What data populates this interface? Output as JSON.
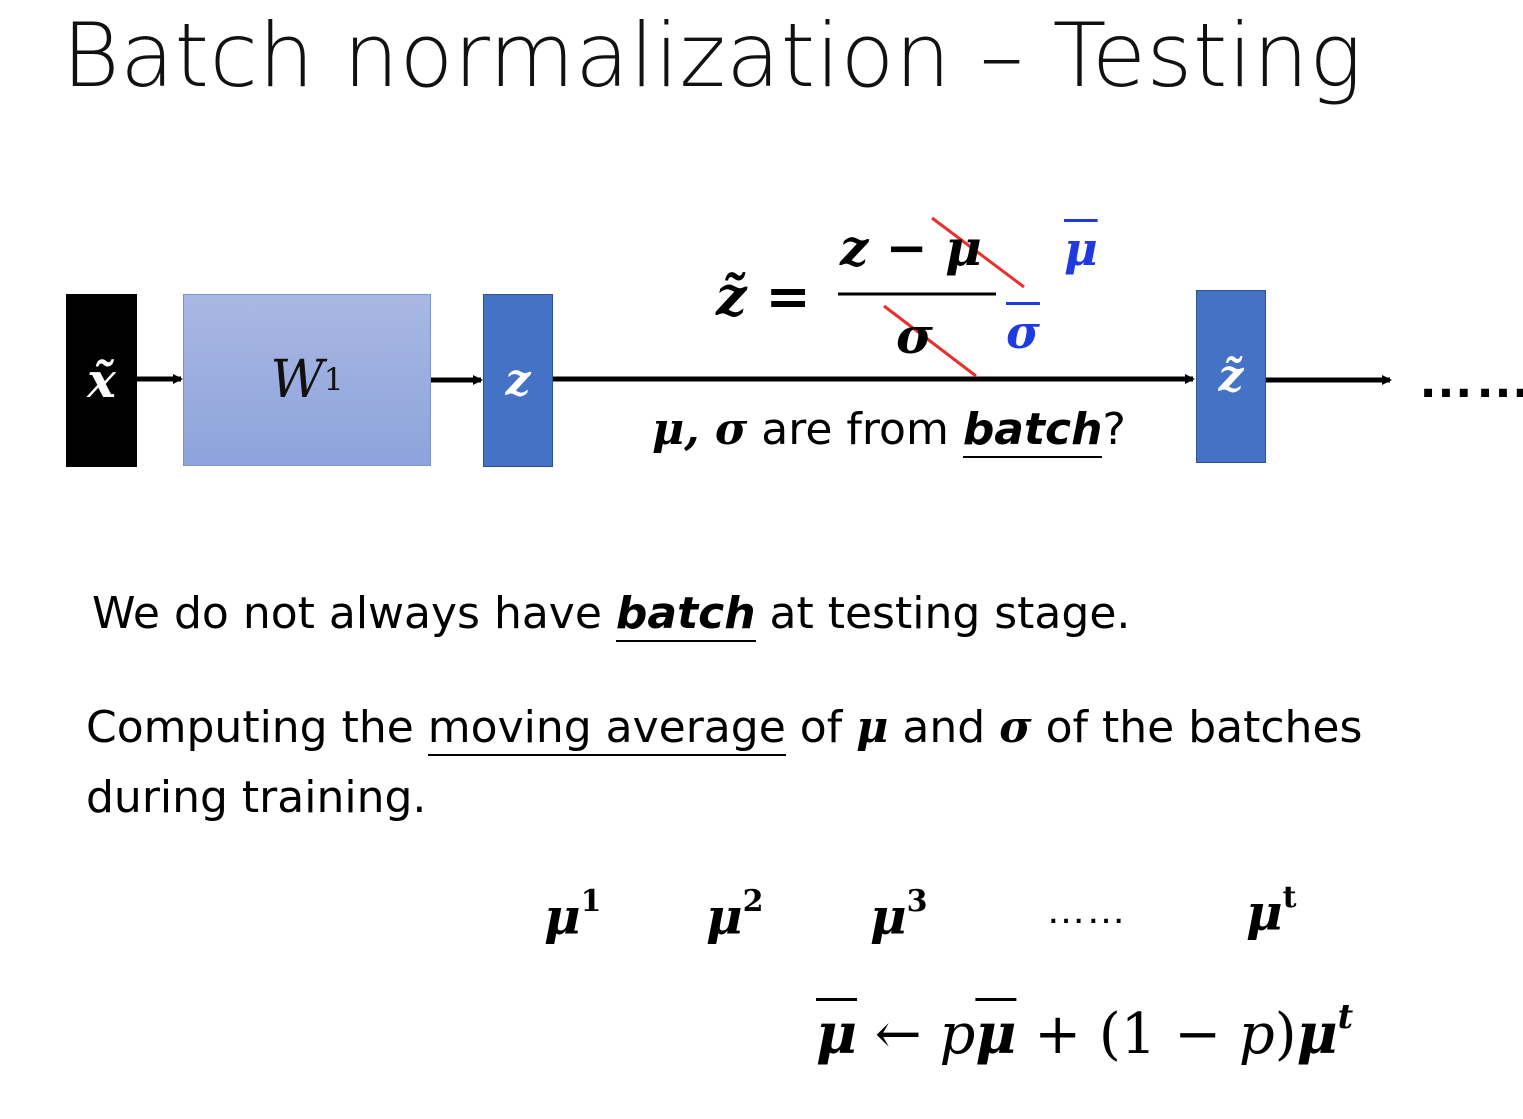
{
  "title": "Batch normalization – Testing",
  "diagram": {
    "input_label": "x̃",
    "weight_label": "W",
    "weight_superscript": "1",
    "z_label": "z",
    "z_tilde_label": "z̃",
    "trailing_dots": "……",
    "formula": {
      "lhs": "z̃ =",
      "numerator": "z − μ",
      "denominator": "σ",
      "replacement_mu": "μ",
      "replacement_sigma": "σ"
    },
    "caption": {
      "prefix": "μ, σ",
      "middle": " are from ",
      "emphasis": "batch",
      "suffix": "?"
    },
    "colors": {
      "black_box": "#000000",
      "weight_box": "#a9b8e3",
      "z_box": "#4472c4",
      "strike": "#e8302f",
      "replacement": "#1f3be0"
    }
  },
  "line1": {
    "prefix": "We do not always have ",
    "emphasis": "batch",
    "suffix": " at testing stage."
  },
  "line2": {
    "prefix": "Computing the ",
    "underlined": "moving average",
    "of1": " of ",
    "mu": "μ",
    "and": " and ",
    "sigma": "σ",
    "rest": " of the batches",
    "line2b": "during training."
  },
  "mu_sequence": [
    {
      "base": "μ",
      "sup": "1"
    },
    {
      "base": "μ",
      "sup": "2"
    },
    {
      "base": "μ",
      "sup": "3"
    },
    {
      "base": "……",
      "sup": ""
    },
    {
      "base": "μ",
      "sup": "t"
    }
  ],
  "update_rule": {
    "lhs": "μ",
    "arrow": " ← ",
    "p1": "p",
    "mu_bar": "μ",
    "plus": " + (1 − ",
    "p2": "p",
    "close": ")",
    "mu": "μ",
    "sup": "t"
  }
}
